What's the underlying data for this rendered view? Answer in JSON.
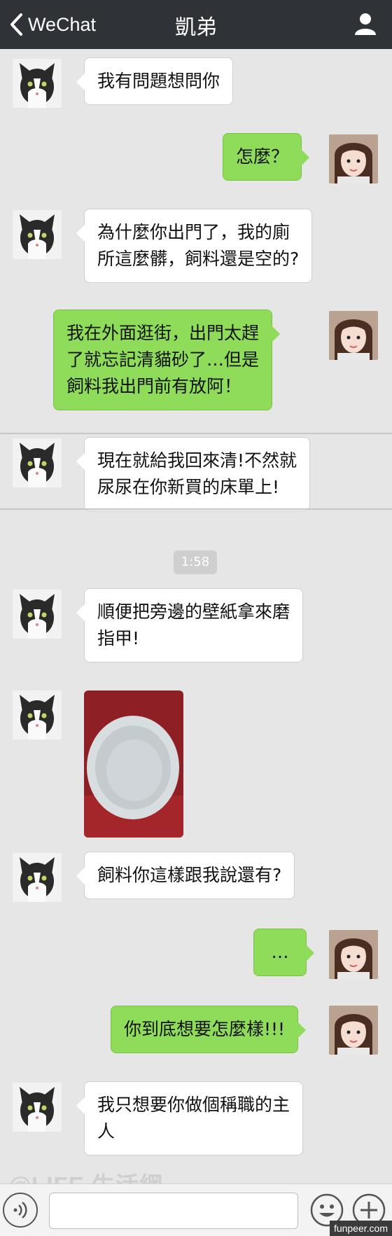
{
  "header": {
    "back_label": "WeChat",
    "title": "凱弟"
  },
  "messages": [
    {
      "from": "cat",
      "lines": [
        "我有問題想問你"
      ]
    },
    {
      "from": "me",
      "lines": [
        "怎麼？"
      ]
    },
    {
      "from": "cat",
      "lines": [
        "為什麼你出門了，我的廁",
        "所這麼髒，飼料還是空的?"
      ]
    },
    {
      "from": "me",
      "lines": [
        "我在外面逛街，出門太趕",
        "了就忘記清貓砂了…但是",
        "飼料我出門前有放阿！"
      ]
    },
    {
      "from": "cat",
      "lines": [
        "現在就給我回來清!不然就",
        "尿尿在你新買的床單上!"
      ]
    },
    {
      "from": "cat",
      "lines": [
        "順便把旁邊的壁紙拿來磨",
        "指甲!"
      ]
    },
    {
      "from": "cat",
      "lines": [
        "飼料你這樣跟我說還有?"
      ]
    },
    {
      "from": "me",
      "lines": [
        "…"
      ]
    },
    {
      "from": "me",
      "lines": [
        "你到底想要怎麼樣!!!"
      ]
    },
    {
      "from": "cat",
      "lines": [
        "我只想要你做個稱職的主",
        "人"
      ]
    }
  ],
  "timestamp": "1:58",
  "watermark": "@LIFE 生活網",
  "credit": "funpeer.com",
  "colors": {
    "header_bg": "#2f3236",
    "chat_bg": "#e6e6e6",
    "outgoing_bubble": "#8fdc5a",
    "incoming_bubble": "#ffffff"
  }
}
